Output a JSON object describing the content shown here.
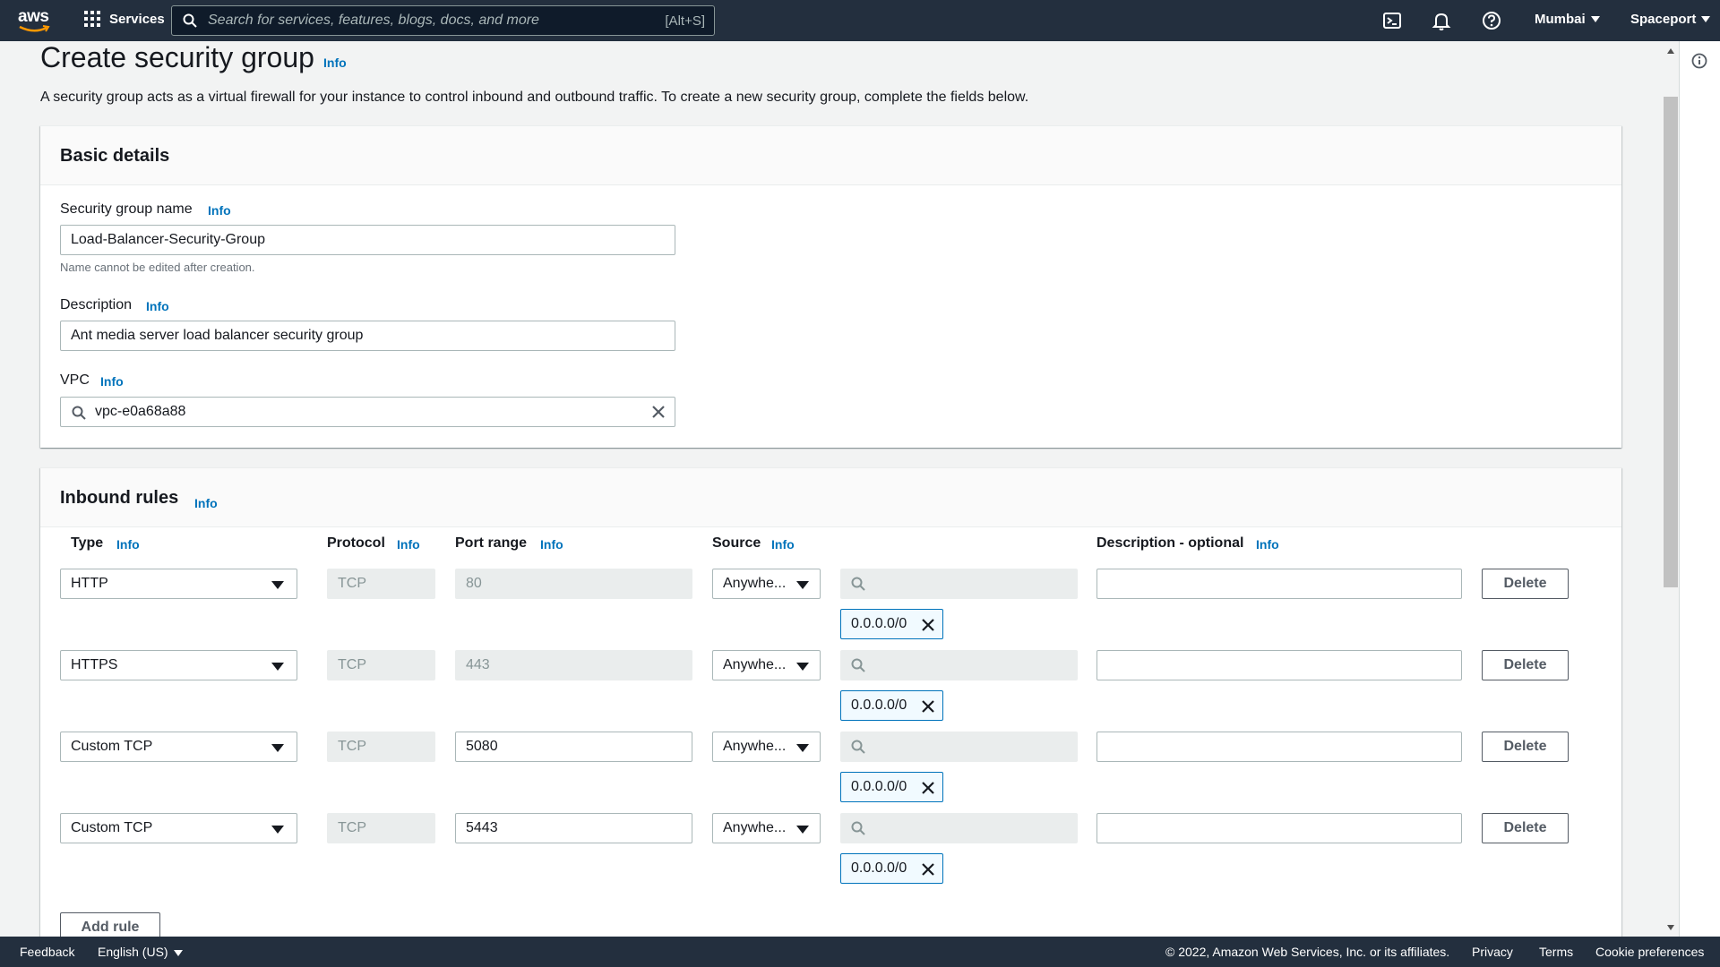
{
  "topnav": {
    "logo_text": "aws",
    "services_label": "Services",
    "search_placeholder": "Search for services, features, blogs, docs, and more",
    "search_shortcut": "[Alt+S]",
    "region_label": "Mumbai",
    "account_label": "Spaceport",
    "icons": [
      "cloudshell-icon",
      "bell-icon",
      "help-icon"
    ]
  },
  "page": {
    "title": "Create security group",
    "title_info": "Info",
    "description": "A security group acts as a virtual firewall for your instance to control inbound and outbound traffic. To create a new security group, complete the fields below."
  },
  "basic_details": {
    "heading": "Basic details",
    "name_label": "Security group name",
    "name_info": "Info",
    "name_value": "Load-Balancer-Security-Group",
    "name_hint": "Name cannot be edited after creation.",
    "description_label": "Description",
    "description_info": "Info",
    "description_value": "Ant media server load balancer security group",
    "vpc_label": "VPC",
    "vpc_info": "Info",
    "vpc_value": "vpc-e0a68a88"
  },
  "inbound_rules": {
    "heading": "Inbound rules",
    "heading_info": "Info",
    "columns": {
      "type": "Type",
      "protocol": "Protocol",
      "port_range": "Port range",
      "source": "Source",
      "description": "Description - optional",
      "info": "Info"
    },
    "rows": [
      {
        "type": "HTTP",
        "protocol": "TCP",
        "port": "80",
        "port_editable": false,
        "source": "Anywhe...",
        "cidr": "0.0.0.0/0",
        "description": "",
        "delete_label": "Delete"
      },
      {
        "type": "HTTPS",
        "protocol": "TCP",
        "port": "443",
        "port_editable": false,
        "source": "Anywhe...",
        "cidr": "0.0.0.0/0",
        "description": "",
        "delete_label": "Delete"
      },
      {
        "type": "Custom TCP",
        "protocol": "TCP",
        "port": "5080",
        "port_editable": true,
        "source": "Anywhe...",
        "cidr": "0.0.0.0/0",
        "description": "",
        "delete_label": "Delete"
      },
      {
        "type": "Custom TCP",
        "protocol": "TCP",
        "port": "5443",
        "port_editable": true,
        "source": "Anywhe...",
        "cidr": "0.0.0.0/0",
        "description": "",
        "delete_label": "Delete"
      }
    ],
    "add_rule_label": "Add rule"
  },
  "footer": {
    "feedback": "Feedback",
    "language": "English (US)",
    "copyright": "© 2022, Amazon Web Services, Inc. or its affiliates.",
    "privacy": "Privacy",
    "terms": "Terms",
    "cookies": "Cookie preferences"
  },
  "colors": {
    "nav_bg": "#232f3e",
    "link": "#0073bb",
    "page_bg": "#f2f3f3"
  }
}
